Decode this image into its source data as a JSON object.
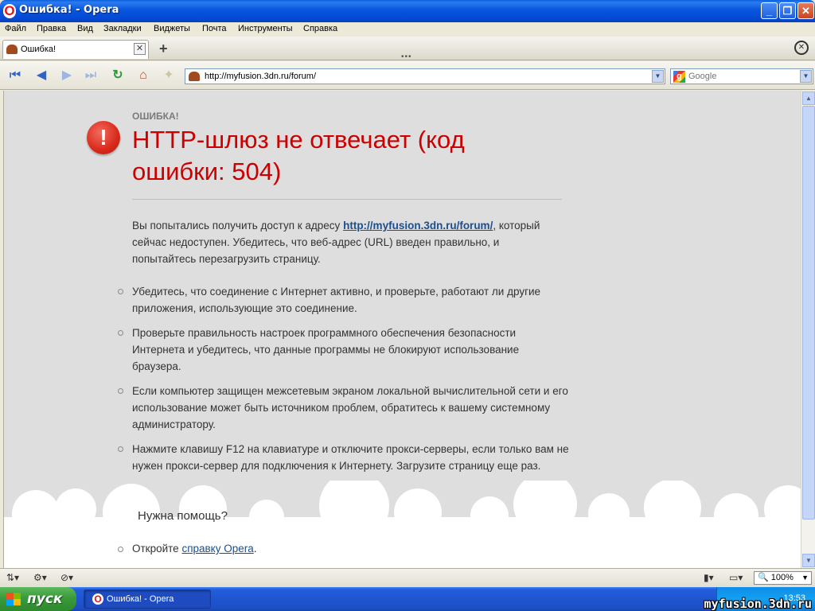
{
  "window": {
    "title": "Ошибка! - Opera"
  },
  "menu": [
    "Файл",
    "Правка",
    "Вид",
    "Закладки",
    "Виджеты",
    "Почта",
    "Инструменты",
    "Справка"
  ],
  "tabs": [
    {
      "label": "Ошибка!"
    }
  ],
  "toolbar": {
    "address": "http://myfusion.3dn.ru/forum/",
    "search_placeholder": "Google",
    "icons": [
      "rewind-icon",
      "back-icon",
      "forward-icon",
      "fast-forward-icon",
      "reload-icon",
      "home-icon",
      "wand-icon"
    ]
  },
  "error": {
    "label": "ОШИБКА!",
    "title": "HTTP-шлюз не отвечает (код ошибки: 504)",
    "intro_before": "Вы попытались получить доступ к адресу ",
    "url": "http://myfusion.3dn.ru/forum/",
    "intro_after": ", который сейчас недоступен. Убедитесь, что веб-адрес (URL) введен правильно, и попытайтесь перезагрузить страницу.",
    "tips": [
      "Убедитесь, что соединение с Интернет активно, и проверьте, работают ли другие приложения, использующие это соединение.",
      "Проверьте правильность настроек программного обеспечения безопасности Интернета и убедитесь, что данные программы не блокируют использование браузера.",
      "Если компьютер защищен межсетевым экраном локальной вычислительной сети и его использование может быть источником проблем, обратитесь к вашему системному администратору.",
      "Нажмите клавишу F12 на клавиатуре и отключите прокси-серверы, если только вам не нужен прокси-сервер для подключения к Интернету. Загрузите страницу еще раз."
    ],
    "help_title": "Нужна помощь?",
    "help_before": "Откройте ",
    "help_link": "справку Opera",
    "help_after": "."
  },
  "status": {
    "zoom": "100%"
  },
  "taskbar": {
    "start_label": "пуск",
    "task_label": "Ошибка! - Opera",
    "clock": "13:53"
  },
  "watermark": "myfusion.3dn.ru",
  "colors": {
    "error_red": "#cc0000",
    "link_blue": "#1a4f8f",
    "page_bg": "#dedede",
    "xp_blue": "#245edb"
  }
}
